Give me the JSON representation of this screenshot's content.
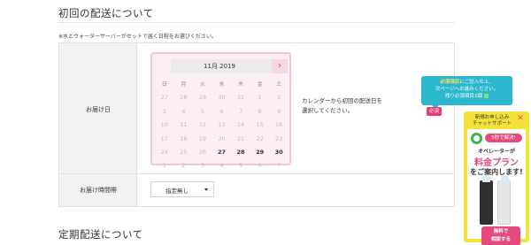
{
  "section1": {
    "title": "初回の配送について",
    "note": "※水とウォーターサーバーがセットで届く日程をお選びください。"
  },
  "delivery_date": {
    "label": "お届け日",
    "calendar": {
      "month": "11月 2019",
      "next_symbol": "›",
      "weekdays": [
        "日",
        "月",
        "火",
        "水",
        "木",
        "金",
        "土"
      ],
      "weeks": [
        [
          "27",
          "28",
          "29",
          "30",
          "31",
          "1",
          "2"
        ],
        [
          "3",
          "4",
          "5",
          "6",
          "7",
          "8",
          "9"
        ],
        [
          "10",
          "11",
          "12",
          "13",
          "14",
          "15",
          "16"
        ],
        [
          "17",
          "18",
          "19",
          "20",
          "21",
          "22",
          "23"
        ],
        [
          "24",
          "25",
          "26",
          "27",
          "28",
          "29",
          "30"
        ],
        [
          "1",
          "2",
          "3",
          "4",
          "5",
          "6",
          "7"
        ]
      ],
      "available": [
        "27",
        "28",
        "29",
        "30"
      ]
    },
    "instruction_line1": "カレンダーから初回の配送日を",
    "instruction_line2": "選択してください。"
  },
  "delivery_time": {
    "label": "お届け時間帯",
    "selected": "指定無し"
  },
  "section2": {
    "title": "定期配送について"
  },
  "tooltip": {
    "line1_req": "必須項目",
    "line1_rest": "にご記入の上、",
    "line2": "次ページへお進みください。",
    "line3_pre": "残り必須項目",
    "line3_count": "1",
    "line3_unit": "個",
    "badge": "必須"
  },
  "chat": {
    "title_line1": "新規お申し込み",
    "title_line2": "チャットサポート",
    "close": "✕",
    "badge": "5秒で解決!",
    "line1": "オペレーターが",
    "line2": "料金プラン",
    "line3": "をご案内します!",
    "button_line1": "無料で",
    "button_line2": "相談する"
  },
  "colors": {
    "accent_pink": "#e64a7d",
    "calendar_bg": "#fdeef3",
    "tooltip_bg": "#2bb7cd",
    "chat_bg": "#f4e23a"
  }
}
